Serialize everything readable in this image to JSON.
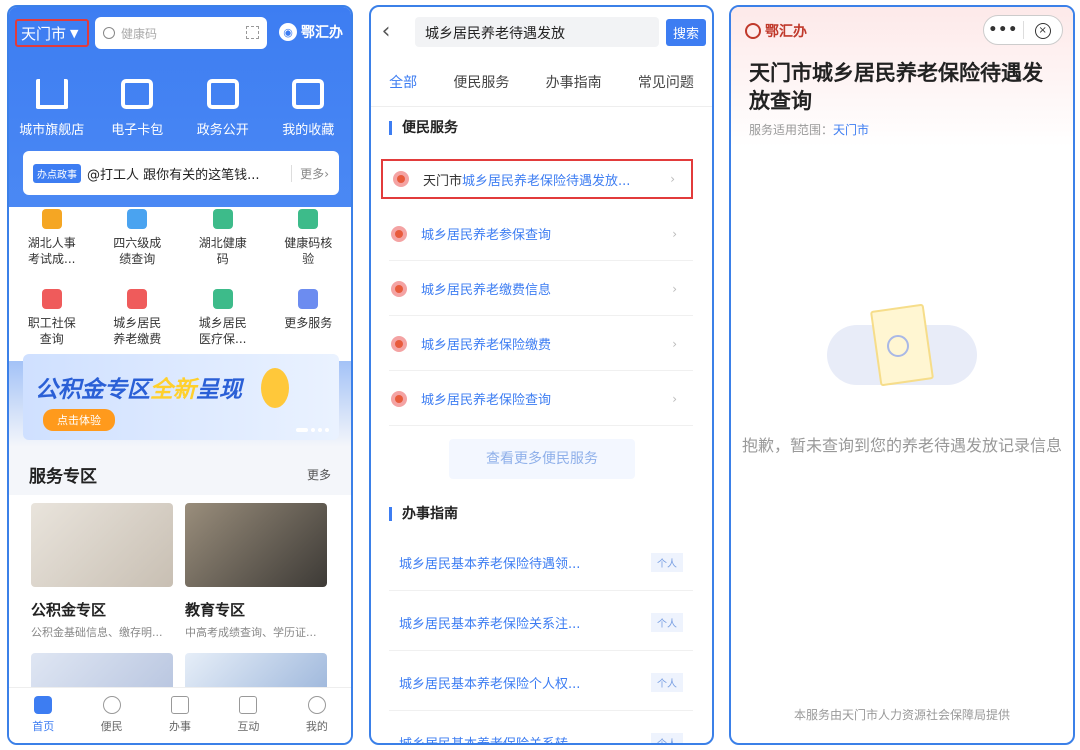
{
  "phone1": {
    "city": "天门市",
    "search_placeholder": "健康码",
    "brand": "鄂汇办",
    "quick": [
      {
        "label": "城市旗舰店"
      },
      {
        "label": "电子卡包"
      },
      {
        "label": "政务公开"
      },
      {
        "label": "我的收藏"
      }
    ],
    "notice": {
      "tag": "办点政事",
      "text": "@打工人 跟你有关的这笔钱...",
      "more": "更多"
    },
    "grid": [
      {
        "l1": "湖北人事",
        "l2": "考试成...",
        "color": "#f5a623"
      },
      {
        "l1": "四六级成",
        "l2": "绩查询",
        "color": "#4aa3f0"
      },
      {
        "l1": "湖北健康",
        "l2": "码",
        "color": "#3dbb8a"
      },
      {
        "l1": "健康码核",
        "l2": "验",
        "color": "#3dbb8a"
      },
      {
        "l1": "职工社保",
        "l2": "查询",
        "color": "#ef5b5b"
      },
      {
        "l1": "城乡居民",
        "l2": "养老缴费",
        "color": "#ef5b5b"
      },
      {
        "l1": "城乡居民",
        "l2": "医疗保...",
        "color": "#3dbb8a"
      },
      {
        "l1": "更多服务",
        "l2": "",
        "color": "#6c8cf0"
      }
    ],
    "banner": {
      "title_a": "公积金专区",
      "title_b": "全新",
      "title_c": "呈现",
      "button": "点击体验"
    },
    "section": {
      "title": "服务专区",
      "more": "更多"
    },
    "cards": [
      {
        "title": "公积金专区",
        "sub": "公积金基础信息、缴存明..."
      },
      {
        "title": "教育专区",
        "sub": "中高考成绩查询、学历证..."
      }
    ],
    "tabs": [
      {
        "label": "首页"
      },
      {
        "label": "便民"
      },
      {
        "label": "办事"
      },
      {
        "label": "互动"
      },
      {
        "label": "我的"
      }
    ]
  },
  "phone2": {
    "query": "城乡居民养老待遇发放",
    "search_btn": "搜索",
    "tabs": [
      "全部",
      "便民服务",
      "办事指南",
      "常见问题"
    ],
    "section1": "便民服务",
    "services": [
      {
        "prefix": "天门市",
        "hit": "城乡居民养老保险待遇发放..."
      },
      {
        "prefix": "",
        "hit": "城乡居民养老参保查询"
      },
      {
        "prefix": "",
        "hit": "城乡居民养老缴费信息"
      },
      {
        "prefix": "",
        "hit": "城乡居民养老保险缴费"
      },
      {
        "prefix": "",
        "hit": "城乡居民养老保险查询"
      }
    ],
    "more_services": "查看更多便民服务",
    "section2": "办事指南",
    "guides": [
      {
        "text": "城乡居民基本养老保险待遇领...",
        "tag": "个人"
      },
      {
        "text": "城乡居民基本养老保险关系注...",
        "tag": "个人"
      },
      {
        "text": "城乡居民基本养老保险个人权...",
        "tag": "个人"
      },
      {
        "text": "城乡居民基本养老保险关系转...",
        "tag": "个人"
      }
    ]
  },
  "phone3": {
    "brand": "鄂汇办",
    "capsule_more": "•••",
    "close": "×",
    "title": "天门市城乡居民养老保险待遇发放查询",
    "scope_label": "服务适用范围：",
    "scope_value": "天门市",
    "empty_msg": "抱歉，暂未查询到您的养老待遇发放记录信息",
    "footer": "本服务由天门市人力资源社会保障局提供"
  }
}
